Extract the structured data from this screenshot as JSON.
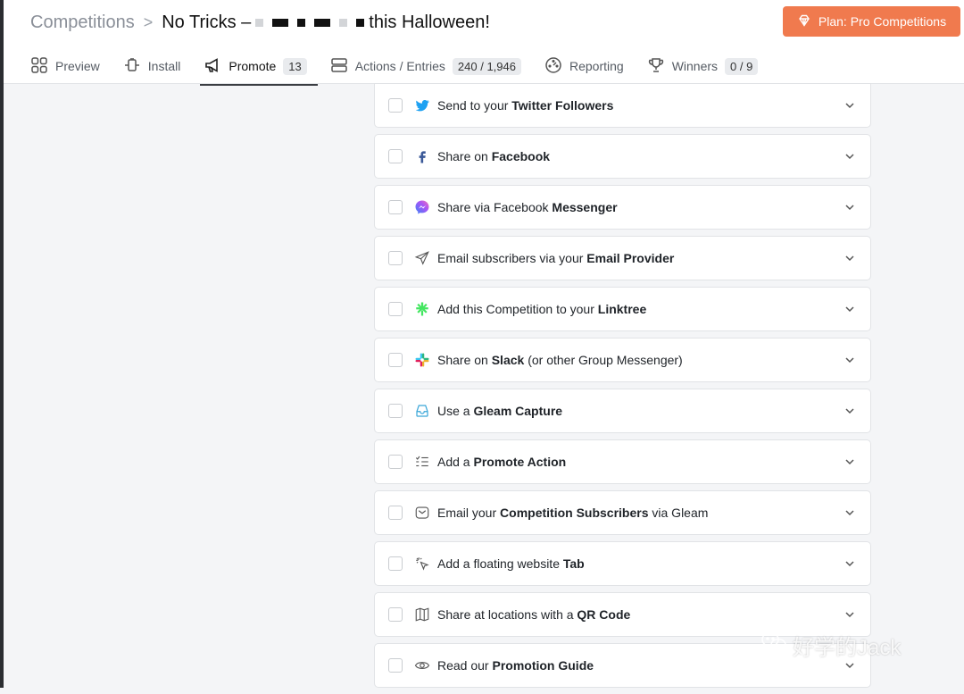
{
  "breadcrumb": {
    "root": "Competitions",
    "separator": ">",
    "title_prefix": "No Tricks –",
    "title_suffix": "this Halloween!"
  },
  "plan_button": {
    "label": "Plan: Pro Competitions",
    "icon": "diamond-icon",
    "color": "#f07a4e"
  },
  "tabs": [
    {
      "label": "Preview",
      "icon": "grid-icon"
    },
    {
      "label": "Install",
      "icon": "plug-icon"
    },
    {
      "label": "Promote",
      "icon": "megaphone-icon",
      "badge": "13",
      "active": true
    },
    {
      "label": "Actions / Entries",
      "icon": "stack-icon",
      "badge": "240 / 1,946"
    },
    {
      "label": "Reporting",
      "icon": "gauge-icon"
    },
    {
      "label": "Winners",
      "icon": "trophy-icon",
      "badge": "0 / 9"
    }
  ],
  "items": [
    {
      "icon": "twitter-icon",
      "pre": "Send to your ",
      "bold": "Twitter Followers",
      "post": ""
    },
    {
      "icon": "facebook-icon",
      "pre": "Share on ",
      "bold": "Facebook",
      "post": ""
    },
    {
      "icon": "messenger-icon",
      "pre": "Share via Facebook ",
      "bold": "Messenger",
      "post": ""
    },
    {
      "icon": "paper-plane-icon",
      "pre": "Email subscribers via your ",
      "bold": "Email Provider",
      "post": ""
    },
    {
      "icon": "linktree-icon",
      "pre": "Add this Competition to your ",
      "bold": "Linktree",
      "post": ""
    },
    {
      "icon": "slack-icon",
      "pre": "Share on ",
      "bold": "Slack",
      "post": " (or other Group Messenger)"
    },
    {
      "icon": "inbox-icon",
      "pre": "Use a ",
      "bold": "Gleam Capture",
      "post": ""
    },
    {
      "icon": "checklist-icon",
      "pre": "Add a ",
      "bold": "Promote Action",
      "post": ""
    },
    {
      "icon": "mail-icon",
      "pre": "Email your ",
      "bold": "Competition Subscribers",
      "post": " via Gleam"
    },
    {
      "icon": "cursor-click-icon",
      "pre": "Add a floating website ",
      "bold": "Tab",
      "post": ""
    },
    {
      "icon": "map-icon",
      "pre": "Share at locations with a ",
      "bold": "QR Code",
      "post": ""
    },
    {
      "icon": "eye-icon",
      "pre": "Read our ",
      "bold": "Promotion Guide",
      "post": ""
    }
  ],
  "watermark": "好学的Jack"
}
